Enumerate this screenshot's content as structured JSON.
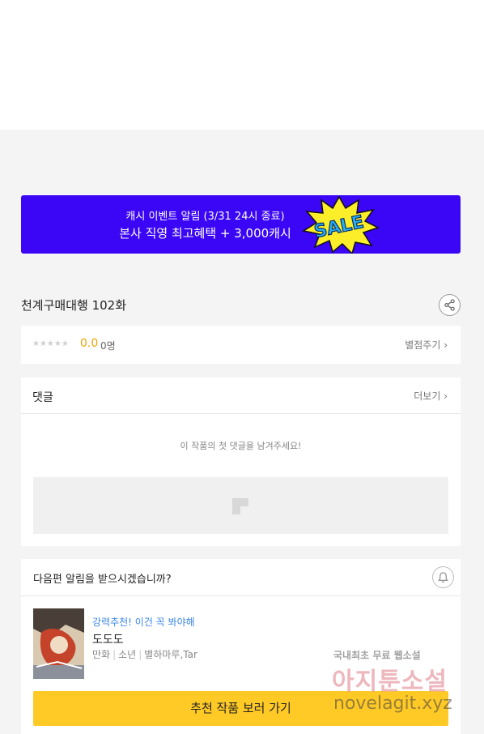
{
  "banner": {
    "line1": "캐시 이벤트 알림 (3/31 24시 종료)",
    "line2": "본사 직영 최고혜택 + 3,000캐시",
    "sale_text": "SALE",
    "bg_color": "#3a06f5"
  },
  "episode": {
    "title": "천계구매대행 102화",
    "share_icon": "share-icon"
  },
  "rating": {
    "stars": "★★★★★",
    "score": "0.0",
    "count": "0명",
    "rate_label": "별점주기 ›"
  },
  "comments": {
    "title": "댓글",
    "more_label": "더보기 ›",
    "empty_text": "이 작품의 첫 댓글을 남겨주세요!"
  },
  "notify": {
    "question": "다음편 알림을 받으시겠습니까?",
    "bell_icon": "bell-icon"
  },
  "recommendation": {
    "tag": "강력추천! 이건 꼭 봐야해",
    "title": "도도도",
    "genre": "만화",
    "category": "소년",
    "authors": "별하마루,Tar",
    "button_label": "추천 작품 보러 가기",
    "button_color": "#ffc926"
  },
  "watermark": {
    "line1": "국내최초 무료 웹소설",
    "line2": "아지툰소설",
    "line3": "novelagit.xyz"
  }
}
